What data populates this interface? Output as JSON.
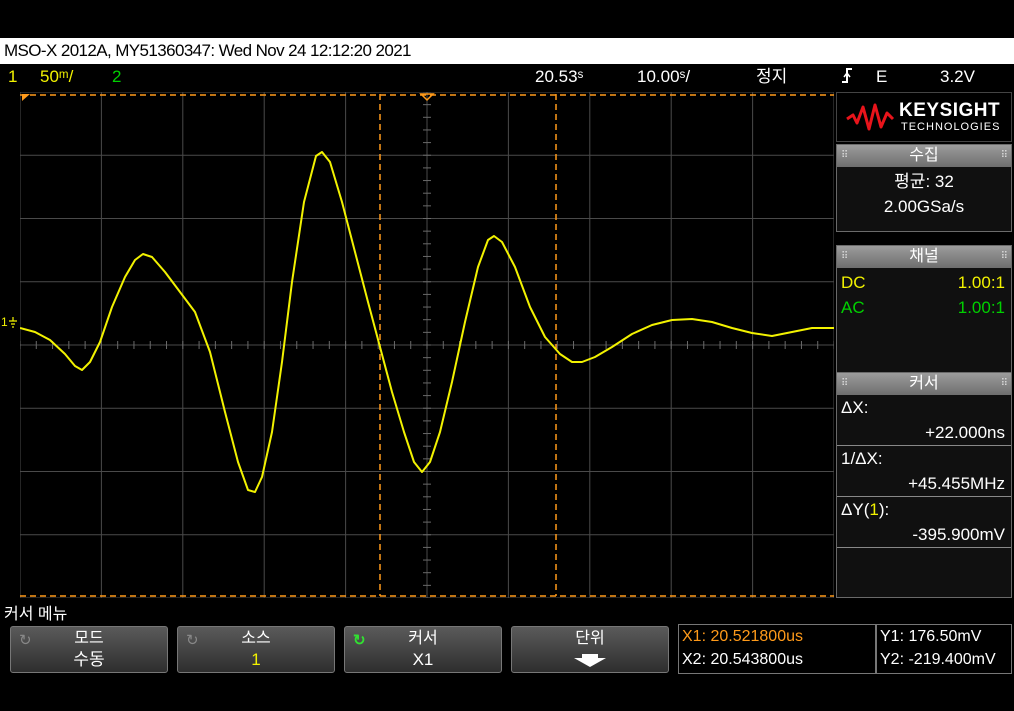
{
  "title_bar": "MSO-X 2012A, MY51360347: Wed Nov 24 12:12:20 2021",
  "status": {
    "ch1_num": "1",
    "ch1_scale": "50ᵐ/",
    "ch2_num": "2",
    "time_delay": "20.53ˢ",
    "time_scale": "10.00ˢ/",
    "run_state": "정지",
    "trigger_icon": "trigger-edge-icon",
    "trigger_source": "E",
    "trigger_level": "3.2V"
  },
  "ch1_marker": "1",
  "logo": {
    "name": "KEYSIGHT",
    "sub": "TECHNOLOGIES"
  },
  "acquire": {
    "title": "수집",
    "mode": "평균: 32",
    "rate": "2.00GSa/s"
  },
  "channel": {
    "title": "채널",
    "rows": [
      {
        "coupling": "DC",
        "probe": "1.00:1"
      },
      {
        "coupling": "AC",
        "probe": "1.00:1"
      }
    ]
  },
  "cursor_panel": {
    "title": "커서",
    "dx_label": "ΔX:",
    "dx_value": "+22.000ns",
    "inv_dx_label": "1/ΔX:",
    "inv_dx_value": "+45.455MHz",
    "dy_label_pre": "ΔY(",
    "dy_label_src": "1",
    "dy_label_post": "):",
    "dy_value": "-395.900mV"
  },
  "menu_title": "커서 메뉴",
  "softkeys": [
    {
      "top": "모드",
      "bottom": "수동"
    },
    {
      "top": "소스",
      "bottom": "1"
    },
    {
      "top": "커서",
      "bottom": "X1"
    },
    {
      "top": "단위",
      "bottom": ""
    }
  ],
  "readouts": {
    "x1": "X1: 20.521800us",
    "x2": "X2: 20.543800us",
    "y1": "Y1: 176.50mV",
    "y2": "Y2: -219.400mV"
  },
  "colors": {
    "ch1": "#f2f200",
    "ch2": "#00d000",
    "cursor": "#ff9a1a",
    "grid": "#5a5a5a",
    "logo_red": "#e8141b"
  }
}
